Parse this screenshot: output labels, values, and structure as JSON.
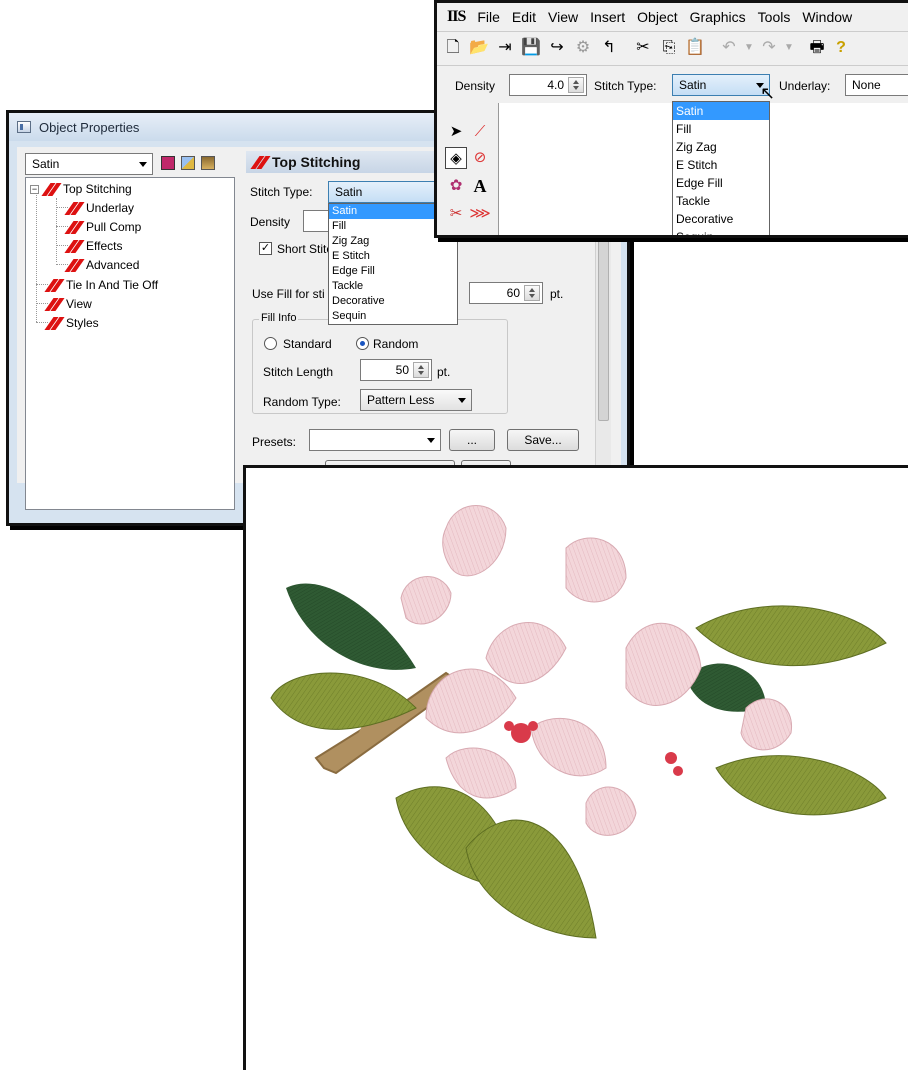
{
  "object_properties": {
    "title": "Object Properties",
    "object_type_value": "Satin",
    "tree": {
      "items": [
        "Top Stitching",
        "Underlay",
        "Pull Comp",
        "Effects",
        "Advanced",
        "Tie In And Tie Off",
        "View",
        "Styles"
      ],
      "expander": "−"
    },
    "panel_title": "Top Stitching",
    "stitch_type_label": "Stitch Type:",
    "stitch_type_value": "Satin",
    "stitch_type_options": [
      "Satin",
      "Fill",
      "Zig Zag",
      "E Stitch",
      "Edge Fill",
      "Tackle",
      "Decorative",
      "Sequin"
    ],
    "density_label": "Density",
    "short_stitch_label": "Short Stitc",
    "short_stitch_checked": "✓",
    "use_fill_label": "Use Fill for sti",
    "use_fill_value": "60",
    "use_fill_unit": "pt.",
    "fill_info_label": "Fill Info",
    "standard_label": "Standard",
    "random_label": "Random",
    "stitch_length_label": "Stitch Length",
    "stitch_length_value": "50",
    "stitch_length_unit": "pt.",
    "random_type_label": "Random Type:",
    "random_type_value": "Pattern Less",
    "presets_label": "Presets:",
    "presets_value": "",
    "ellipsis_button": "...",
    "save_button": "Save..."
  },
  "app_window": {
    "app_logo": "IIS",
    "menu": [
      "File",
      "Edit",
      "View",
      "Insert",
      "Object",
      "Graphics",
      "Tools",
      "Window"
    ],
    "density_label": "Density",
    "density_value": "4.0",
    "stitch_type_label": "Stitch Type:",
    "stitch_type_value": "Satin",
    "stitch_type_options": [
      "Satin",
      "Fill",
      "Zig Zag",
      "E Stitch",
      "Edge Fill",
      "Tackle",
      "Decorative",
      "Sequin"
    ],
    "underlay_label": "Underlay:",
    "underlay_value": "None",
    "text_tool_glyph": "A"
  },
  "colors": {
    "selection": "#3399ff",
    "stitch_icon": "#dd1111",
    "petal_pink": "#f3d6da",
    "leaf_green": "#8a9a3a",
    "dark_green": "#2f5a33",
    "stamen_red": "#d93a4a",
    "stem_brown": "#b09060"
  }
}
